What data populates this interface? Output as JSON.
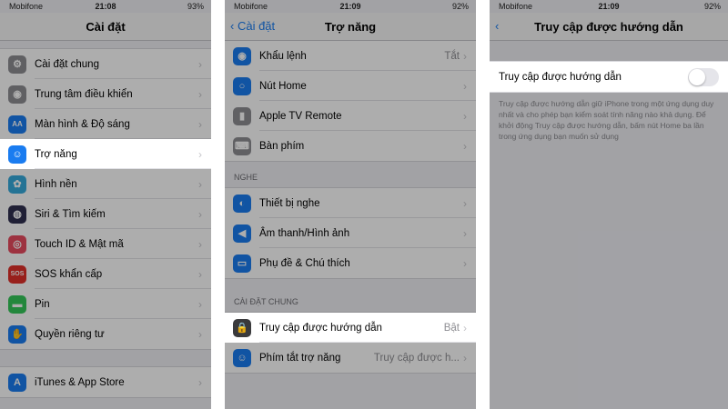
{
  "colors": {
    "accent": "#1a7cf0",
    "background": "#efeff4"
  },
  "screen1": {
    "status": {
      "carrier": "Mobifone",
      "time": "21:08",
      "battery": "93%"
    },
    "title": "Cài đặt",
    "items": [
      {
        "label": "Cài đặt chung",
        "icon": "gear-icon",
        "color": "#8e8e93"
      },
      {
        "label": "Trung tâm điều khiển",
        "icon": "switches-icon",
        "color": "#8e8e93"
      },
      {
        "label": "Màn hình & Độ sáng",
        "icon": "text-size-icon",
        "color": "#1a7cf0"
      },
      {
        "label": "Trợ năng",
        "icon": "accessibility-icon",
        "color": "#1a7cf0"
      },
      {
        "label": "Hình nền",
        "icon": "flower-icon",
        "color": "#36aadc"
      },
      {
        "label": "Siri & Tìm kiếm",
        "icon": "siri-icon",
        "color": "#303050"
      },
      {
        "label": "Touch ID & Mật mã",
        "icon": "fingerprint-icon",
        "color": "#e84a5f"
      },
      {
        "label": "SOS khẩn cấp",
        "icon": "sos-icon",
        "color": "#e0302a"
      },
      {
        "label": "Pin",
        "icon": "battery-icon",
        "color": "#34c759"
      },
      {
        "label": "Quyền riêng tư",
        "icon": "hand-icon",
        "color": "#1a7cf0"
      }
    ],
    "items2": [
      {
        "label": "iTunes & App Store",
        "icon": "app-store-icon",
        "color": "#1a7cf0"
      }
    ]
  },
  "screen2": {
    "status": {
      "carrier": "Mobifone",
      "time": "21:09",
      "battery": "92%"
    },
    "back_label": "Cài đặt",
    "title": "Trợ năng",
    "group1": [
      {
        "label": "Khẩu lệnh",
        "value": "Tắt",
        "icon": "voice-control-icon",
        "color": "#1a7cf0"
      },
      {
        "label": "Nút Home",
        "value": "",
        "icon": "home-button-icon",
        "color": "#1a7cf0"
      },
      {
        "label": "Apple TV Remote",
        "value": "",
        "icon": "remote-icon",
        "color": "#8e8e93"
      },
      {
        "label": "Bàn phím",
        "value": "",
        "icon": "keyboard-icon",
        "color": "#8e8e93"
      }
    ],
    "section_hearing": "NGHE",
    "group2": [
      {
        "label": "Thiết bị nghe",
        "icon": "ear-icon",
        "color": "#1a7cf0"
      },
      {
        "label": "Âm thanh/Hình ảnh",
        "icon": "speaker-icon",
        "color": "#1a7cf0"
      },
      {
        "label": "Phụ đề & Chú thích",
        "icon": "caption-icon",
        "color": "#1a7cf0"
      }
    ],
    "section_general": "CÀI ĐẶT CHUNG",
    "group3": [
      {
        "label": "Truy cập được hướng dẫn",
        "value": "Bật",
        "icon": "lock-icon",
        "color": "#3a3a3c"
      },
      {
        "label": "Phím tắt trợ năng",
        "value": "Truy cập được h...",
        "icon": "accessibility-icon",
        "color": "#1a7cf0"
      }
    ]
  },
  "screen3": {
    "status": {
      "carrier": "Mobifone",
      "time": "21:09",
      "battery": "92%"
    },
    "title": "Truy cập được hướng dẫn",
    "toggle_label": "Truy cập được hướng dẫn",
    "toggle_on": false,
    "description": "Truy cập được hướng dẫn giữ iPhone trong một ứng dụng duy nhất và cho phép bạn kiểm soát tính năng nào khả dụng. Để khởi động Truy cập được hướng dẫn, bấm nút Home ba lần trong ứng dụng bạn muốn sử dụng"
  }
}
